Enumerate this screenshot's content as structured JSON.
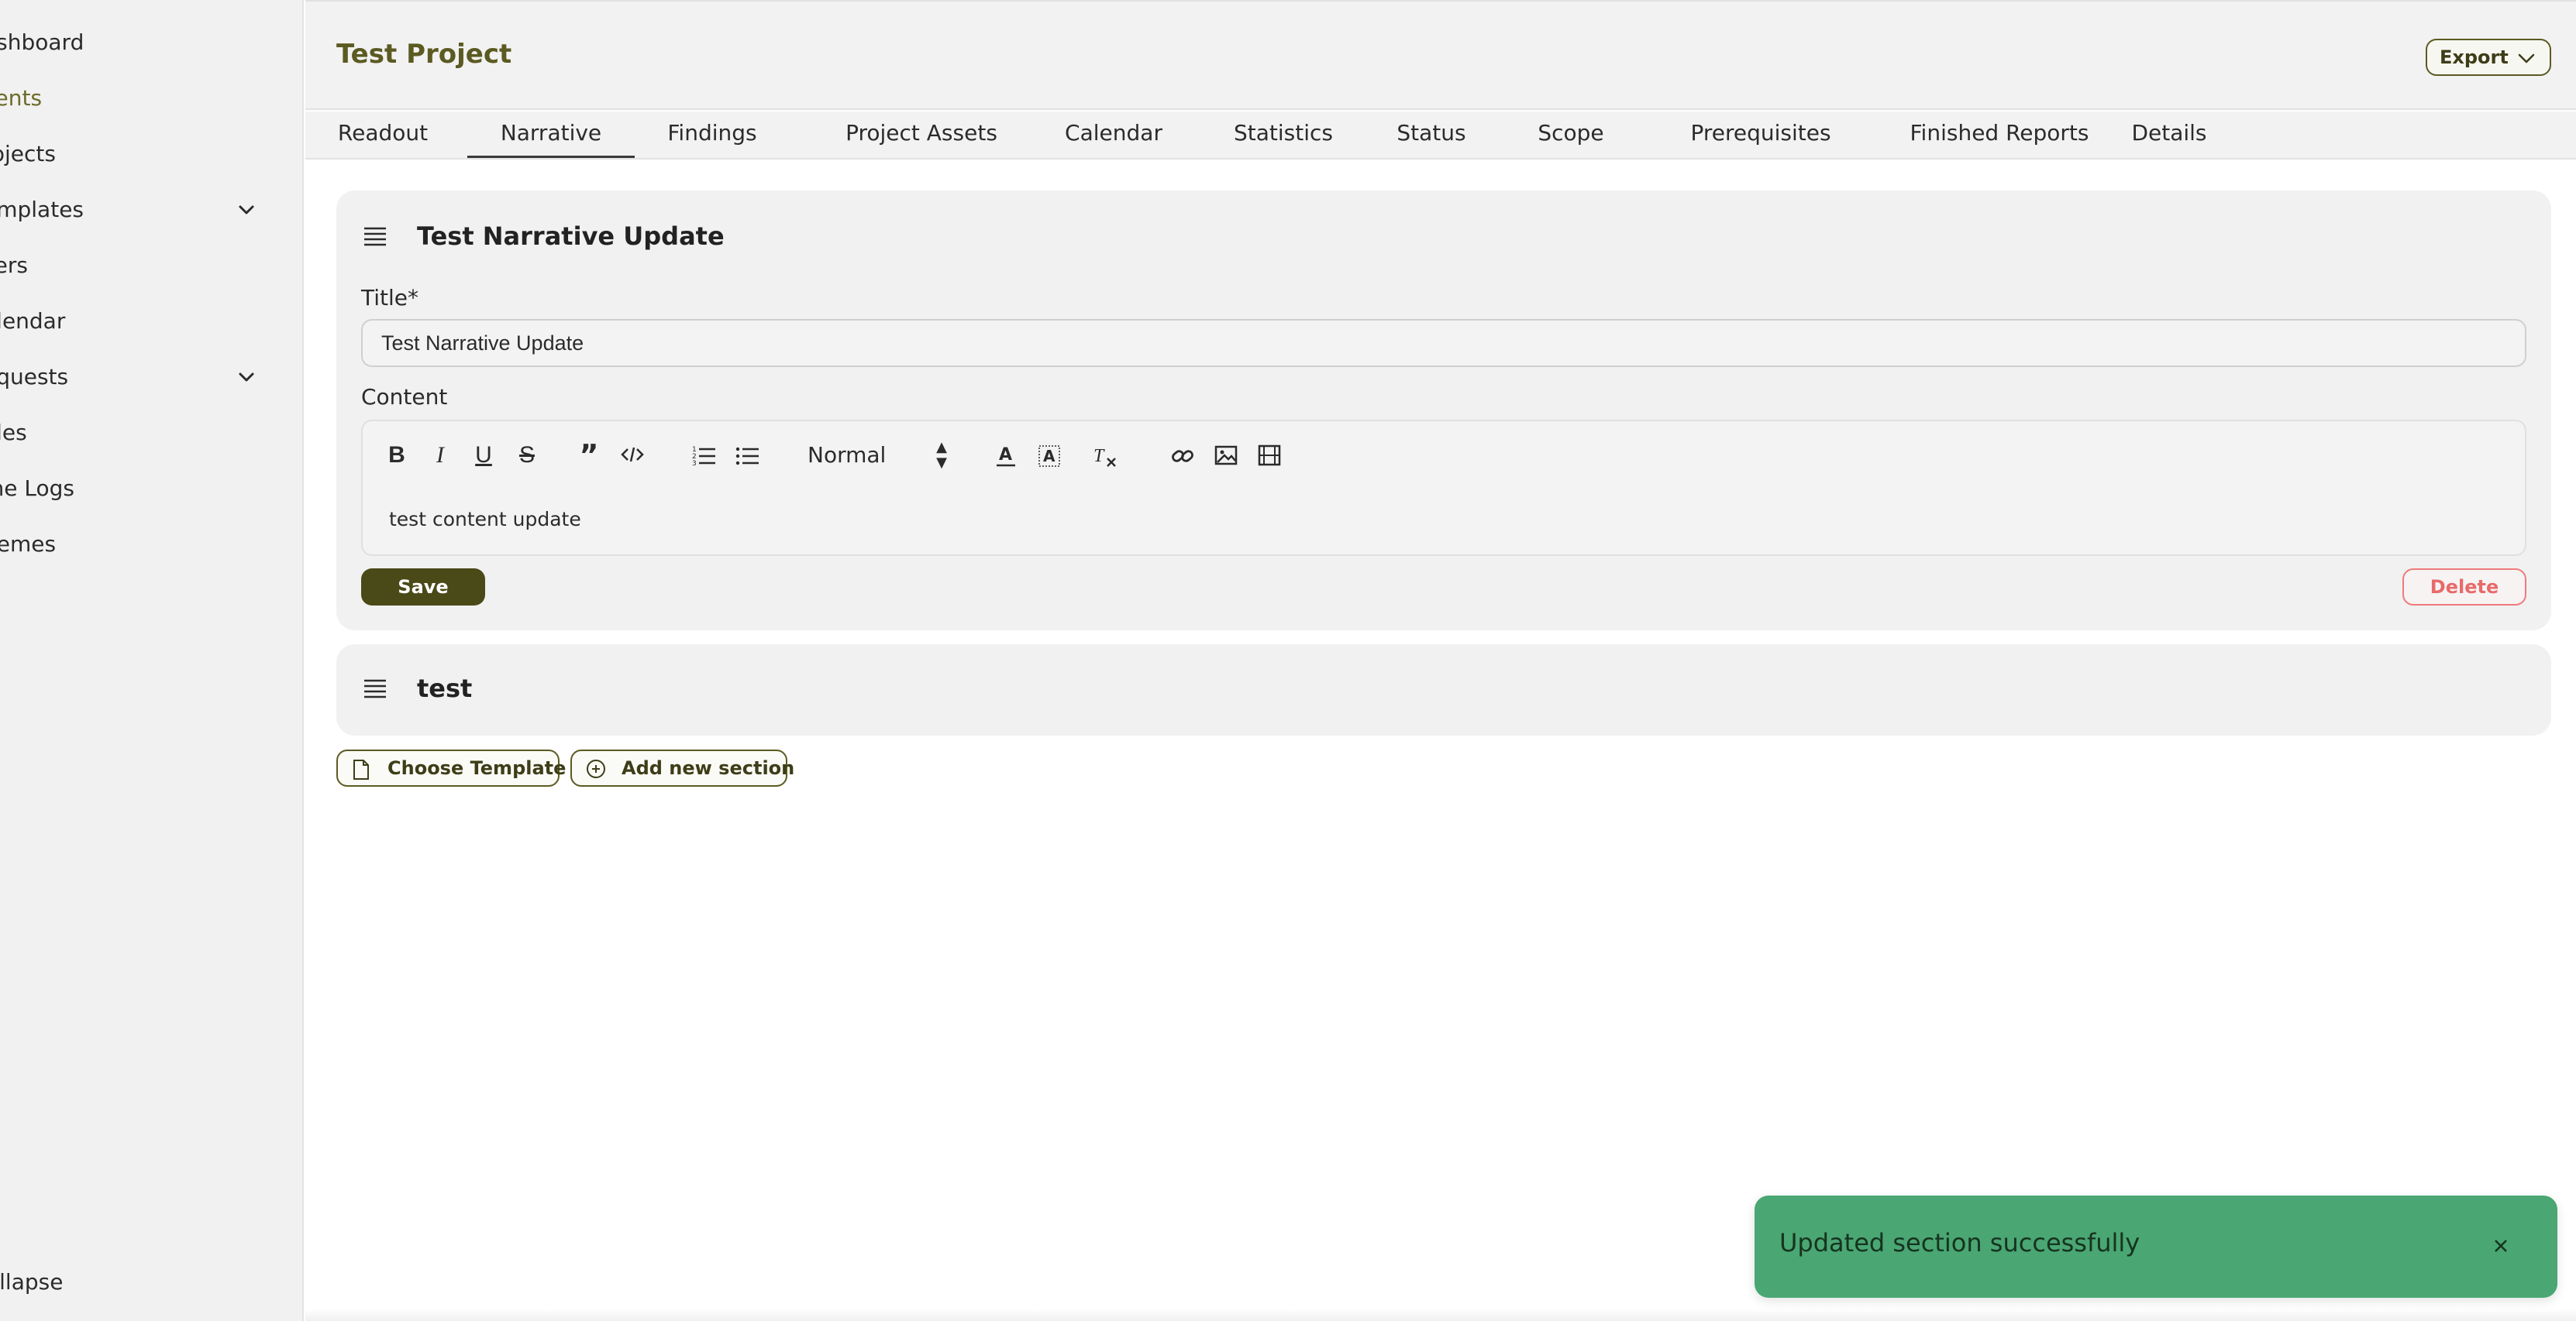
{
  "sidebar": {
    "items": [
      {
        "label": "ashboard"
      },
      {
        "label": "lients"
      },
      {
        "label": "rojects"
      },
      {
        "label": "emplates"
      },
      {
        "label": "sers"
      },
      {
        "label": "alendar"
      },
      {
        "label": "equests"
      },
      {
        "label": "oles"
      },
      {
        "label": "me Logs"
      },
      {
        "label": "hemes"
      }
    ],
    "collapse_label": "ollapse"
  },
  "header": {
    "project_title": "Test Project",
    "export_label": "Export"
  },
  "tabs": [
    {
      "label": "Readout"
    },
    {
      "label": "Narrative"
    },
    {
      "label": "Findings"
    },
    {
      "label": "Project Assets"
    },
    {
      "label": "Calendar"
    },
    {
      "label": "Statistics"
    },
    {
      "label": "Status"
    },
    {
      "label": "Scope"
    },
    {
      "label": "Prerequisites"
    },
    {
      "label": "Finished Reports"
    },
    {
      "label": "Details"
    }
  ],
  "section_editor": {
    "heading": "Test Narrative Update",
    "title_label": "Title*",
    "title_value": "Test Narrative Update",
    "content_label": "Content",
    "format_select": "Normal",
    "content_text": "test content update",
    "save_label": "Save",
    "delete_label": "Delete"
  },
  "section_collapsed": {
    "heading": "test"
  },
  "actions": {
    "choose_template_label": "Choose Template",
    "add_section_label": "Add new section"
  },
  "toast": {
    "message": "Updated section successfully"
  },
  "colors": {
    "accent": "#5b5a22",
    "toast_bg": "#4aa673",
    "delete": "#e86a6a"
  }
}
